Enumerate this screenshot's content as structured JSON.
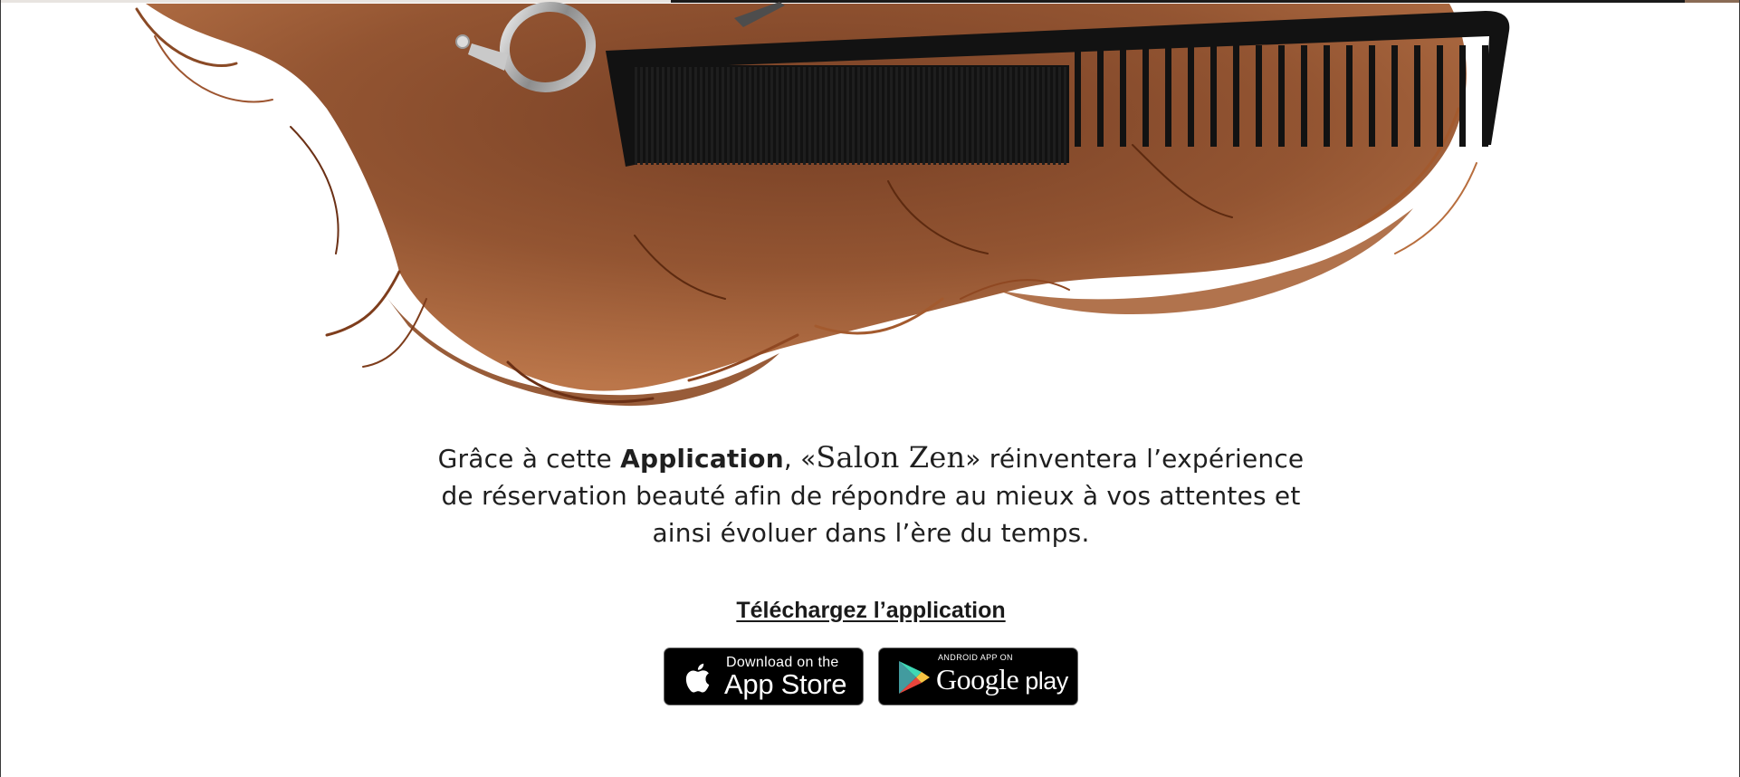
{
  "intro": {
    "part1": "Grâce à cette ",
    "strong": "Application",
    "part2": ", «",
    "brand": "Salon Zen",
    "part3": "» réinventera l’expérience",
    "line2": "de réservation beauté afin de répondre au mieux à vos attentes et",
    "line3": "ainsi évoluer dans l’ère du temps."
  },
  "download": {
    "label": "Téléchargez l’application"
  },
  "stores": {
    "apple": {
      "small": "Download on the",
      "big": "App Store",
      "icon": "apple-icon"
    },
    "google": {
      "small": "ANDROID APP ON",
      "big_google": "Google",
      "big_play": " play",
      "icon": "google-play-icon"
    }
  },
  "colors": {
    "text": "#1f1f1f",
    "hair": "#7a3e1c",
    "comb": "#121212",
    "badge_bg": "#000000"
  }
}
